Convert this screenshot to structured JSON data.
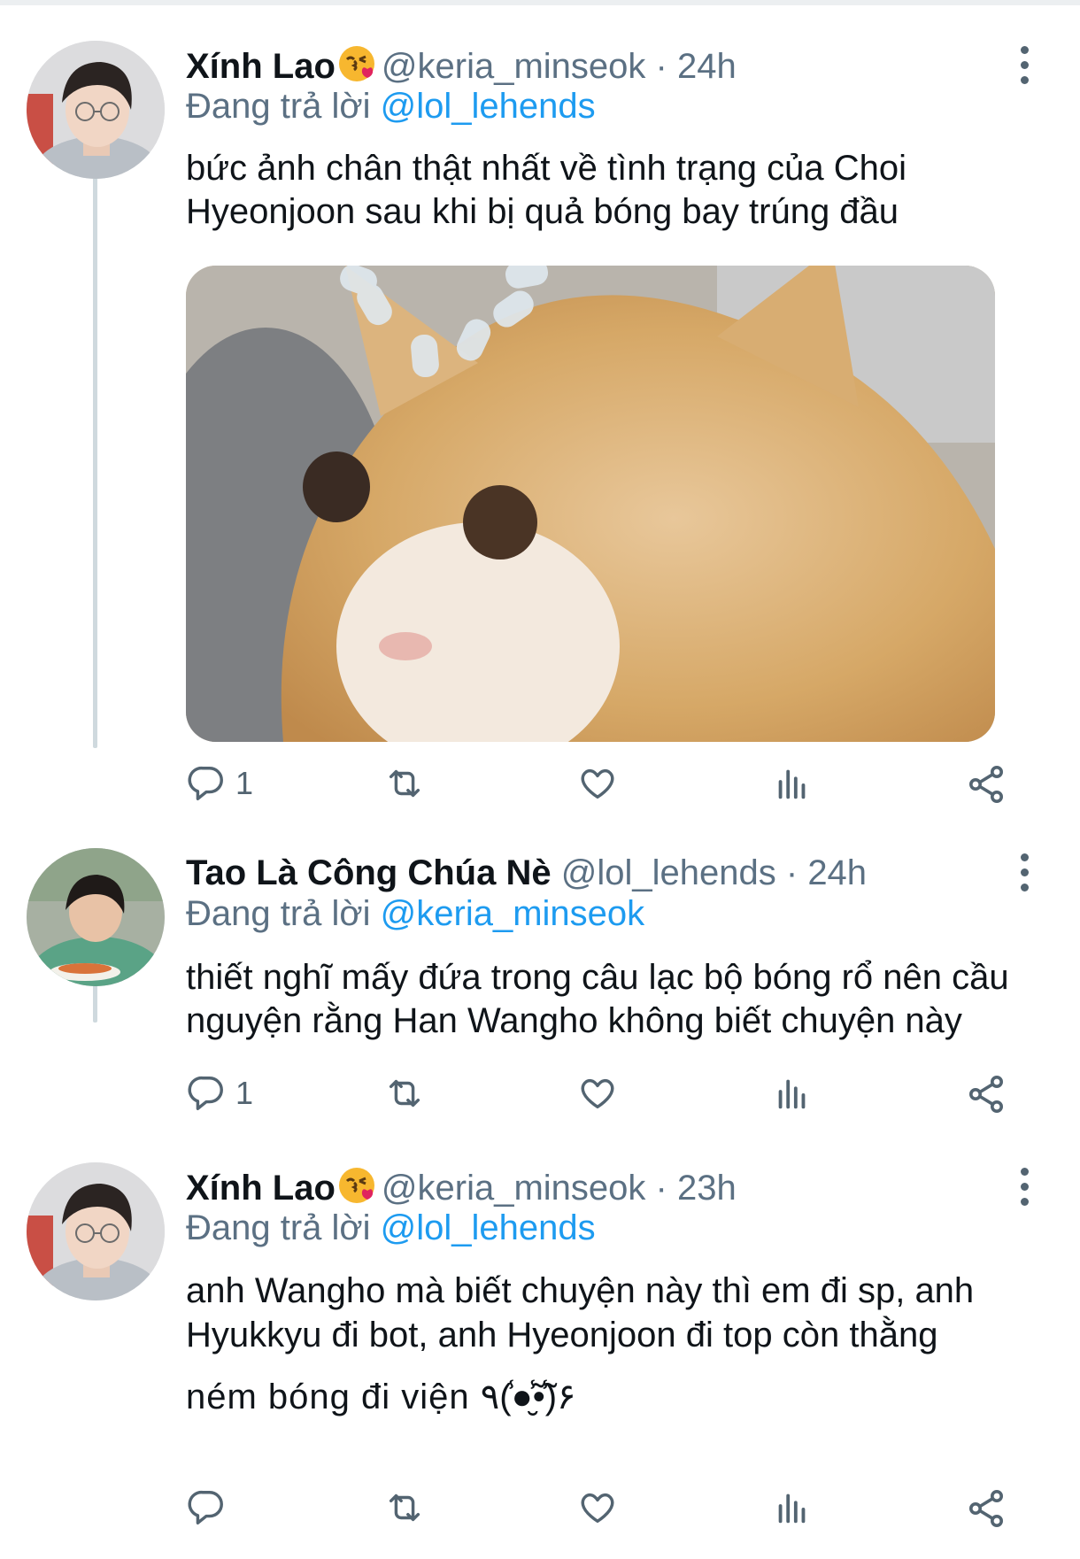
{
  "tweets": [
    {
      "name": "Xính Lao",
      "emoji": "😘",
      "handle": "@keria_minseok",
      "dot": "·",
      "time": "24h",
      "reply_prefix": "Đang trả lời",
      "reply_to": "@lol_lehends",
      "text_lines": [
        "bức ảnh chân thật nhất về tình trạng của Choi",
        "Hyeonjoon sau khi bị quả bóng bay trúng đầu"
      ],
      "reply_count": "1"
    },
    {
      "name": "Tao Là Công Chúa Nè",
      "handle": "@lol_lehends",
      "dot": "·",
      "time": "24h",
      "reply_prefix": "Đang trả lời",
      "reply_to": "@keria_minseok",
      "text_lines": [
        "thiết nghĩ mấy đứa trong câu lạc bộ bóng rổ nên cầu",
        "nguyện rằng Han Wangho không biết chuyện này"
      ],
      "reply_count": "1"
    },
    {
      "name": "Xính Lao",
      "emoji": "😘",
      "handle": "@keria_minseok",
      "dot": "·",
      "time": "23h",
      "reply_prefix": "Đang trả lời",
      "reply_to": "@lol_lehends",
      "text_lines": [
        "anh Wangho mà biết chuyện này thì em đi sp, anh",
        "Hyukkyu đi bot, anh Hyeonjoon đi top còn thằng",
        "ném bóng đi viện ٩(̾●̮̮̃̾•̃̾)۶"
      ],
      "reply_count": ""
    }
  ],
  "icons": [
    "reply-icon",
    "retweet-icon",
    "like-icon",
    "analytics-icon",
    "share-icon",
    "more-icon"
  ],
  "colors": {
    "link": "#1d9bf0",
    "muted": "#5b7083",
    "text": "#0f1419",
    "thread": "#cfd9de"
  }
}
